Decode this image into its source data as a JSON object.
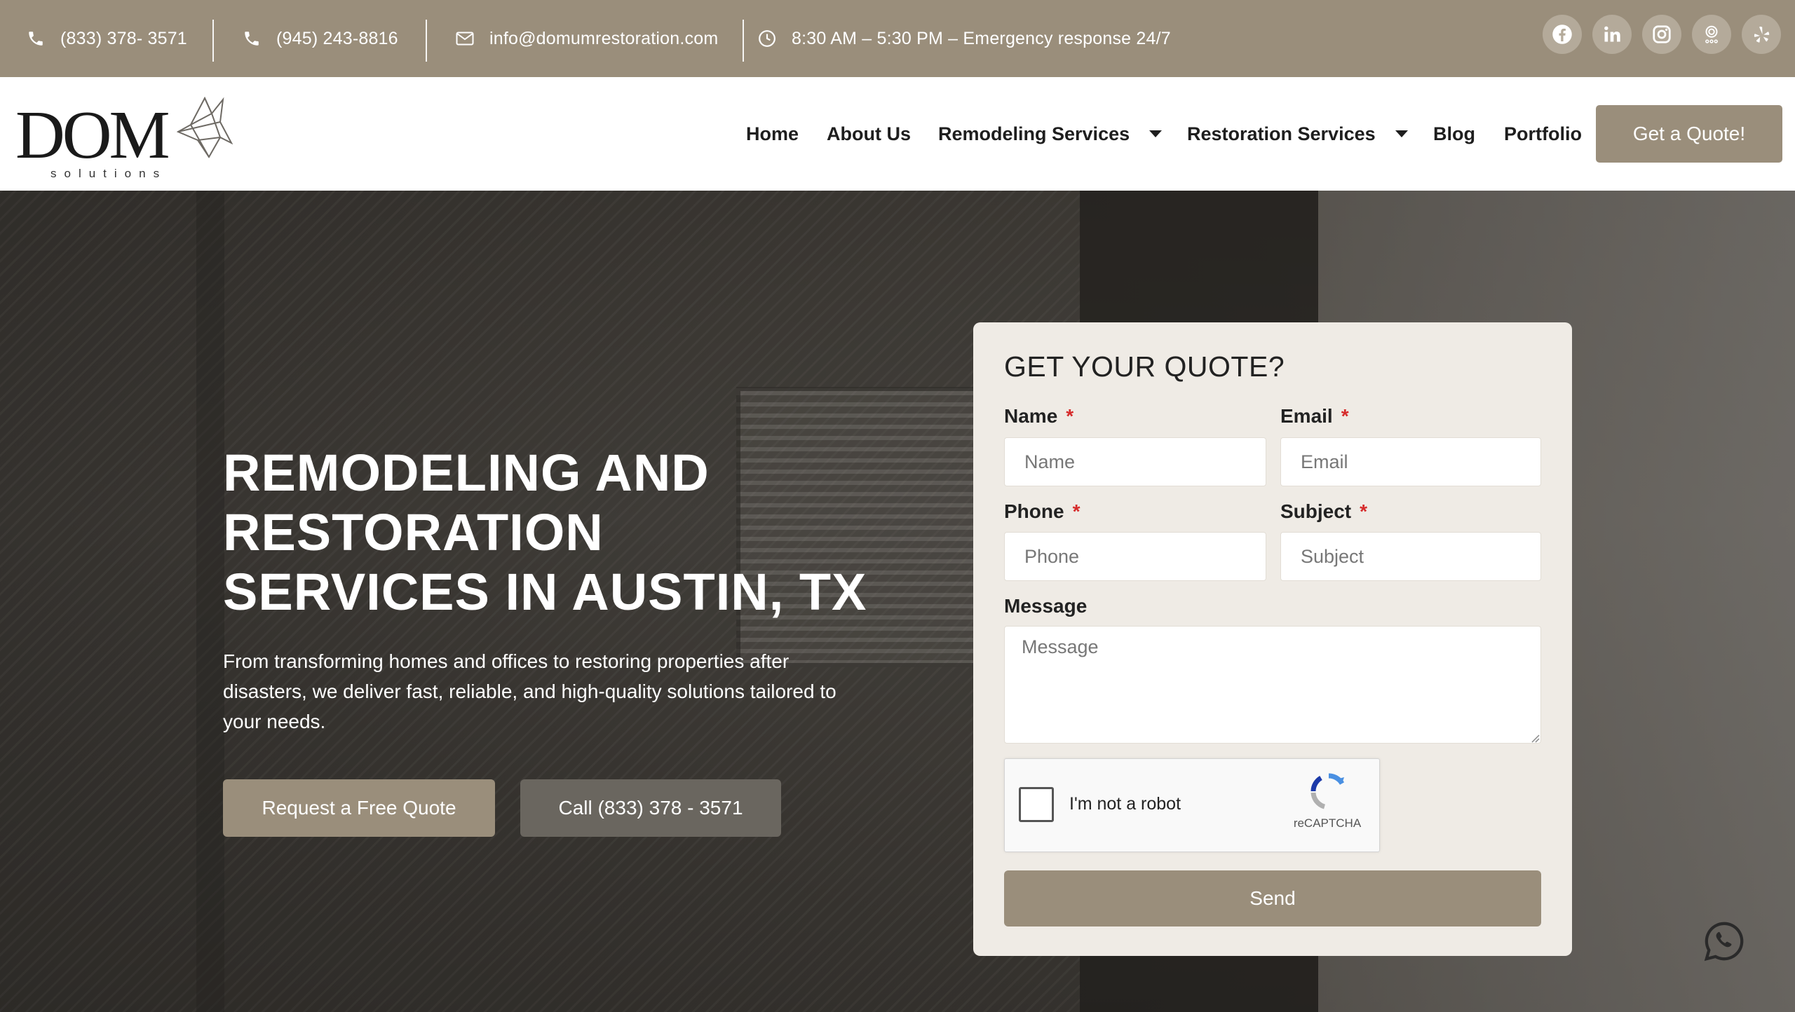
{
  "topbar": {
    "phone1": "(833) 378- 3571",
    "phone2": "(945) 243-8816",
    "email": "info@domumrestoration.com",
    "hours": "8:30 AM – 5:30 PM – Emergency response 24/7",
    "social_icons": [
      "facebook-icon",
      "linkedin-icon",
      "instagram-icon",
      "google-maps-icon",
      "yelp-icon"
    ]
  },
  "brand": {
    "logo_text": "DOM",
    "logo_sub": "solutions"
  },
  "nav": {
    "items": [
      "Home",
      "About Us",
      "Remodeling Services",
      "Restoration Services",
      "Blog",
      "Portfolio"
    ],
    "cta": "Get a Quote!"
  },
  "hero": {
    "title_lines": [
      "REMODELING AND",
      "RESTORATION",
      "SERVICES IN AUSTIN, TX"
    ],
    "lede": "From transforming homes and offices to restoring properties after disasters, we deliver fast, reliable, and high-quality solutions tailored to your needs.",
    "btn_quote": "Request a Free Quote",
    "btn_call": "Call (833) 378 - 3571"
  },
  "form": {
    "title": "GET YOUR QUOTE?",
    "name_label": "Name",
    "name_placeholder": "Name",
    "email_label": "Email",
    "email_placeholder": "Email",
    "phone_label": "Phone",
    "phone_placeholder": "Phone",
    "subject_label": "Subject",
    "subject_placeholder": "Subject",
    "message_label": "Message",
    "message_placeholder": "Message",
    "required_mark": "*",
    "captcha_text": "I'm not a robot",
    "captcha_brand": "reCAPTCHA",
    "send": "Send"
  },
  "colors": {
    "brand": "#9a8e7b",
    "form_bg": "#efebe5",
    "required": "#d62b2b"
  }
}
